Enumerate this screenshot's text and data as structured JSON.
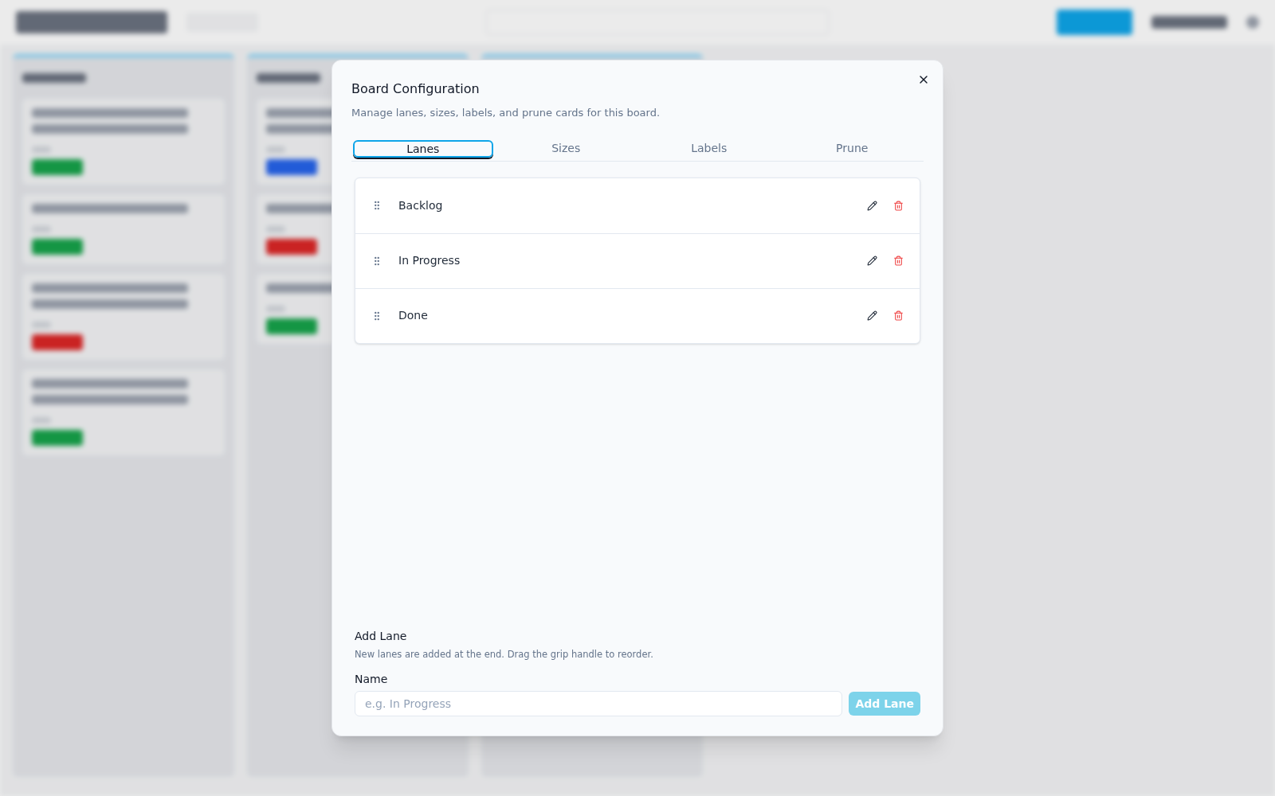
{
  "dialog": {
    "title": "Board Configuration",
    "description": "Manage lanes, sizes, labels, and prune cards for this board.",
    "tabs": [
      {
        "label": "Lanes",
        "selected": true
      },
      {
        "label": "Sizes",
        "selected": false
      },
      {
        "label": "Labels",
        "selected": false
      },
      {
        "label": "Prune",
        "selected": false
      }
    ],
    "lanes": [
      {
        "name": "Backlog"
      },
      {
        "name": "In Progress"
      },
      {
        "name": "Done"
      }
    ],
    "add_lane": {
      "heading": "Add Lane",
      "hint": "New lanes are added at the end. Drag the grip handle to reorder.",
      "field_label": "Name",
      "placeholder": "e.g. In Progress",
      "button": "Add Lane",
      "button_disabled": true
    }
  }
}
